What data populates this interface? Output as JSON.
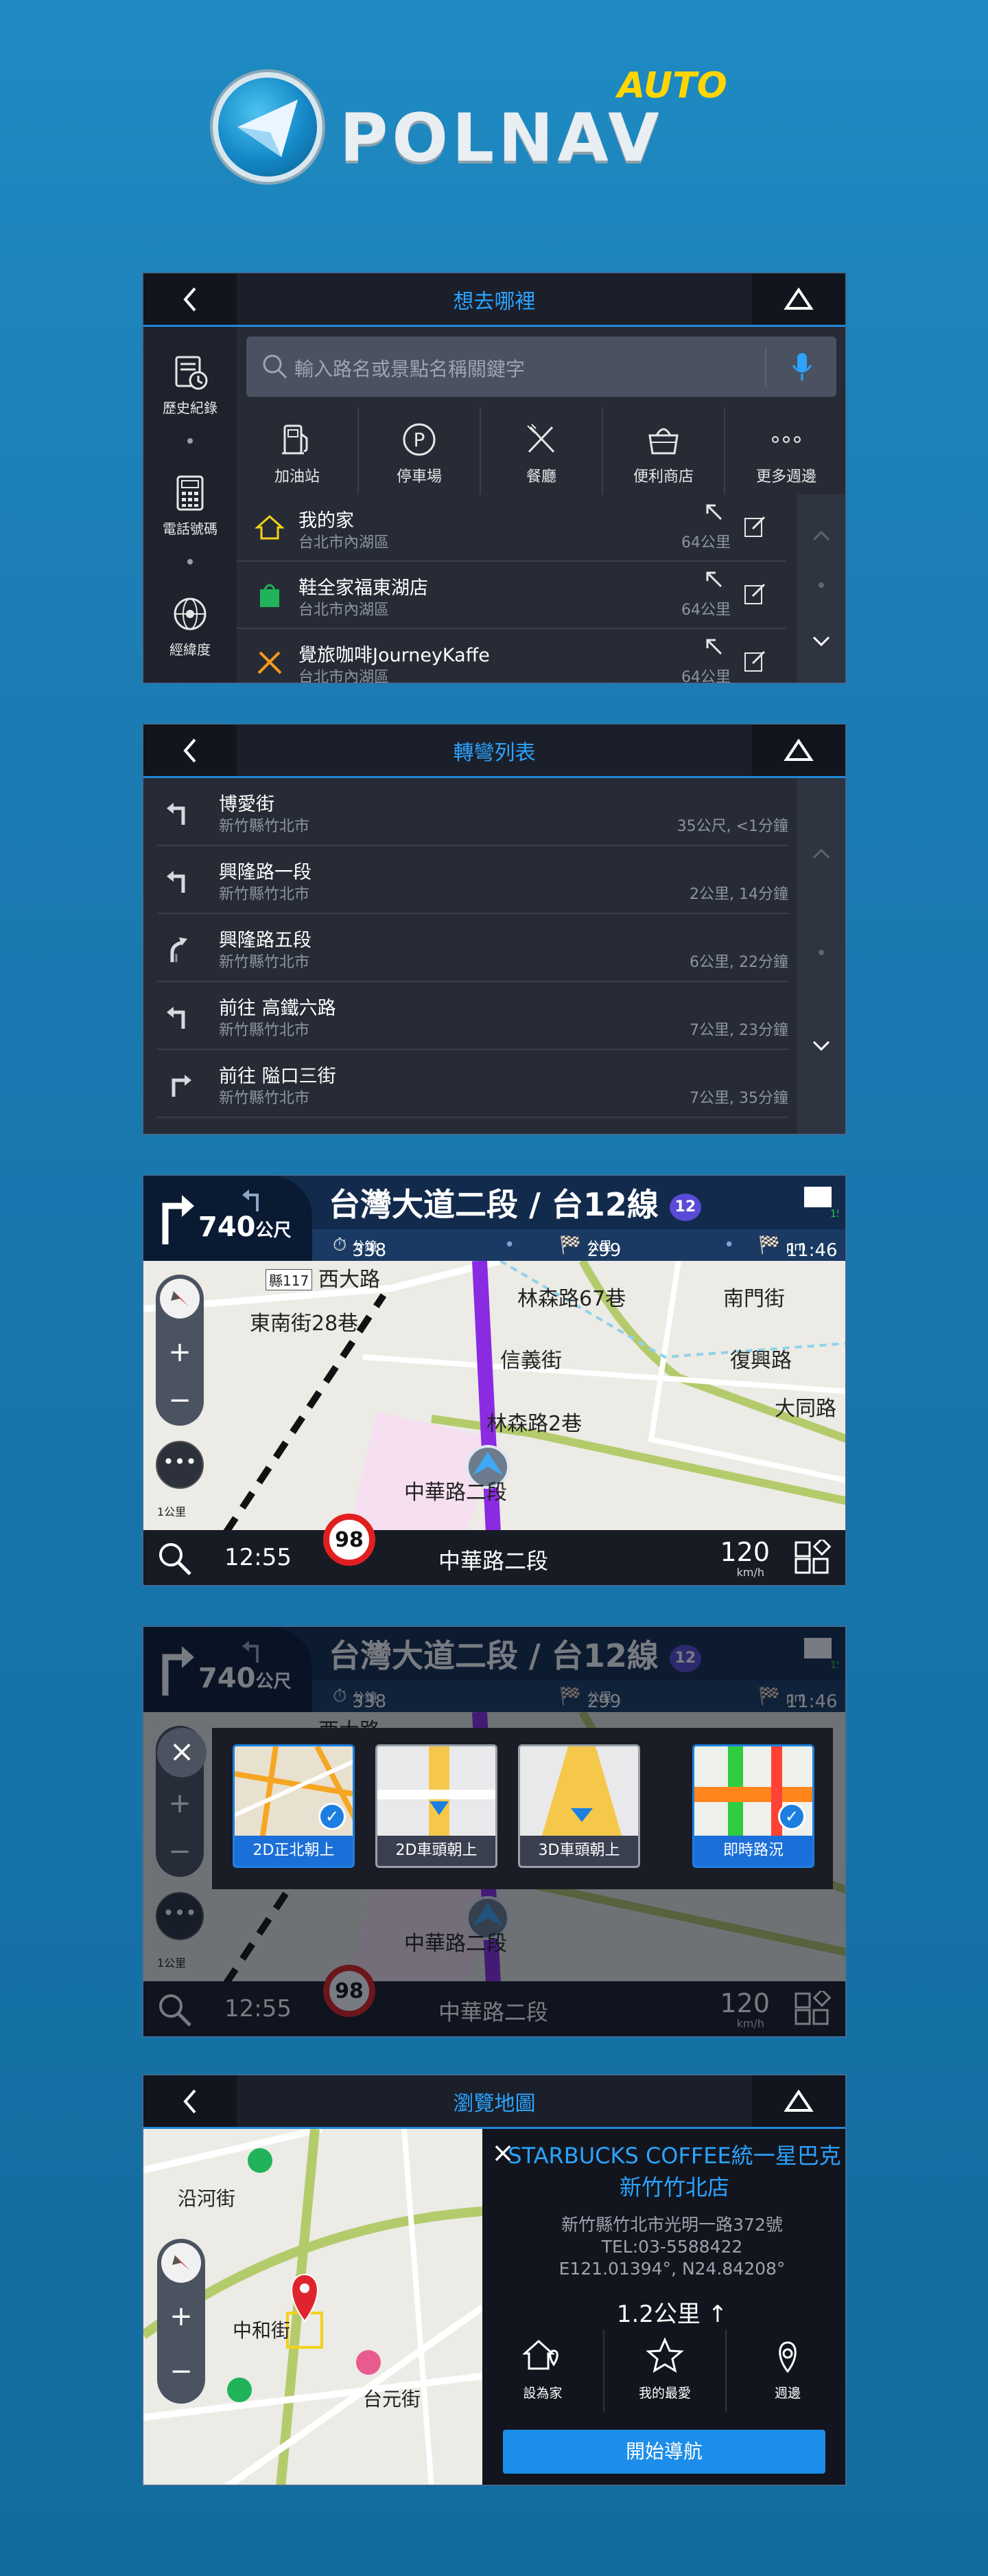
{
  "logo": {
    "brand": "POLNAV",
    "tag": "AUTO"
  },
  "panel1": {
    "title": "想去哪裡",
    "search_placeholder": "輸入路名或景點名稱關鍵字",
    "sidebar": [
      {
        "label": "歷史紀錄",
        "icon": "history-icon"
      },
      {
        "label": "電話號碼",
        "icon": "phone-keypad-icon"
      },
      {
        "label": "經緯度",
        "icon": "globe-icon"
      }
    ],
    "categories": [
      {
        "label": "加油站",
        "icon": "gas-station-icon"
      },
      {
        "label": "停車場",
        "icon": "parking-icon"
      },
      {
        "label": "餐廳",
        "icon": "restaurant-icon"
      },
      {
        "label": "便利商店",
        "icon": "store-icon"
      },
      {
        "label": "更多週邊",
        "icon": "more-icon"
      }
    ],
    "favorites": [
      {
        "name": "我的家",
        "area": "台北市內湖區",
        "dist": "64公里",
        "icon": "home-icon"
      },
      {
        "name": "鞋全家福東湖店",
        "area": "台北市內湖區",
        "dist": "64公里",
        "icon": "shop-bag-icon"
      },
      {
        "name": "覺旅咖啡JourneyKaffe",
        "area": "台北市內湖區",
        "dist": "64公里",
        "icon": "restaurant-icon"
      }
    ]
  },
  "panel2": {
    "title": "轉彎列表",
    "turns": [
      {
        "road": "博愛街",
        "area": "新竹縣竹北市",
        "meta": "35公尺, <1分鐘",
        "icon": "turn-left-icon"
      },
      {
        "road": "興隆路一段",
        "area": "新竹縣竹北市",
        "meta": "2公里, 14分鐘",
        "icon": "turn-left-icon"
      },
      {
        "road": "興隆路五段",
        "area": "新竹縣竹北市",
        "meta": "6公里, 22分鐘",
        "icon": "keep-right-icon"
      },
      {
        "road": "前往 高鐵六路",
        "area": "新竹縣竹北市",
        "meta": "7公里, 23分鐘",
        "icon": "turn-left-icon"
      },
      {
        "road": "前往 隘口三街",
        "area": "新竹縣竹北市",
        "meta": "7公里, 35分鐘",
        "icon": "turn-right-icon"
      }
    ]
  },
  "nav": {
    "turn_dist": "740",
    "turn_unit": "公尺",
    "road": "台灣大道二段 / 台12線",
    "route_no": "12",
    "eta_minutes": "338",
    "eta_minutes_unit": "分鐘",
    "remaining": "299",
    "remaining_unit": "公里",
    "arrival": "11:46",
    "arrival_unit": "pm",
    "gps_count": "15",
    "clock": "12:55",
    "speed_limit": "98",
    "current_road": "中華路二段",
    "speed": "120",
    "speed_unit": "km/h",
    "scale": "1公里",
    "map_labels": [
      "西大路",
      "東南街28巷",
      "林森路67巷",
      "南門街",
      "復興路",
      "信義街",
      "林森路2巷",
      "大同路",
      "中華路二段"
    ],
    "route_badge": "縣117"
  },
  "viewmodes": [
    {
      "label": "2D正北朝上",
      "selected": true
    },
    {
      "label": "2D車頭朝上",
      "selected": false
    },
    {
      "label": "3D車頭朝上",
      "selected": false
    },
    {
      "label": "即時路況",
      "selected": true
    }
  ],
  "panel5": {
    "title": "瀏覽地圖",
    "poi_name": "STARBUCKS COFFEE統一星巴克新竹竹北店",
    "address": "新竹縣竹北市光明一路372號",
    "tel": "TEL:03-5588422",
    "coords": "E121.01394°, N24.84208°",
    "distance": "1.2公里",
    "actions": [
      {
        "label": "設為家",
        "icon": "home-pin-icon"
      },
      {
        "label": "我的最愛",
        "icon": "star-icon"
      },
      {
        "label": "週邊",
        "icon": "nearby-pin-icon"
      }
    ],
    "start_label": "開始導航",
    "map_labels": [
      "沿河街",
      "中和街",
      "台元街"
    ]
  },
  "colors": {
    "accent": "#1d89d9",
    "title_blue": "#2ba3ff",
    "route_purple": "#8a2be2",
    "brand_yellow": "#ffd600"
  }
}
